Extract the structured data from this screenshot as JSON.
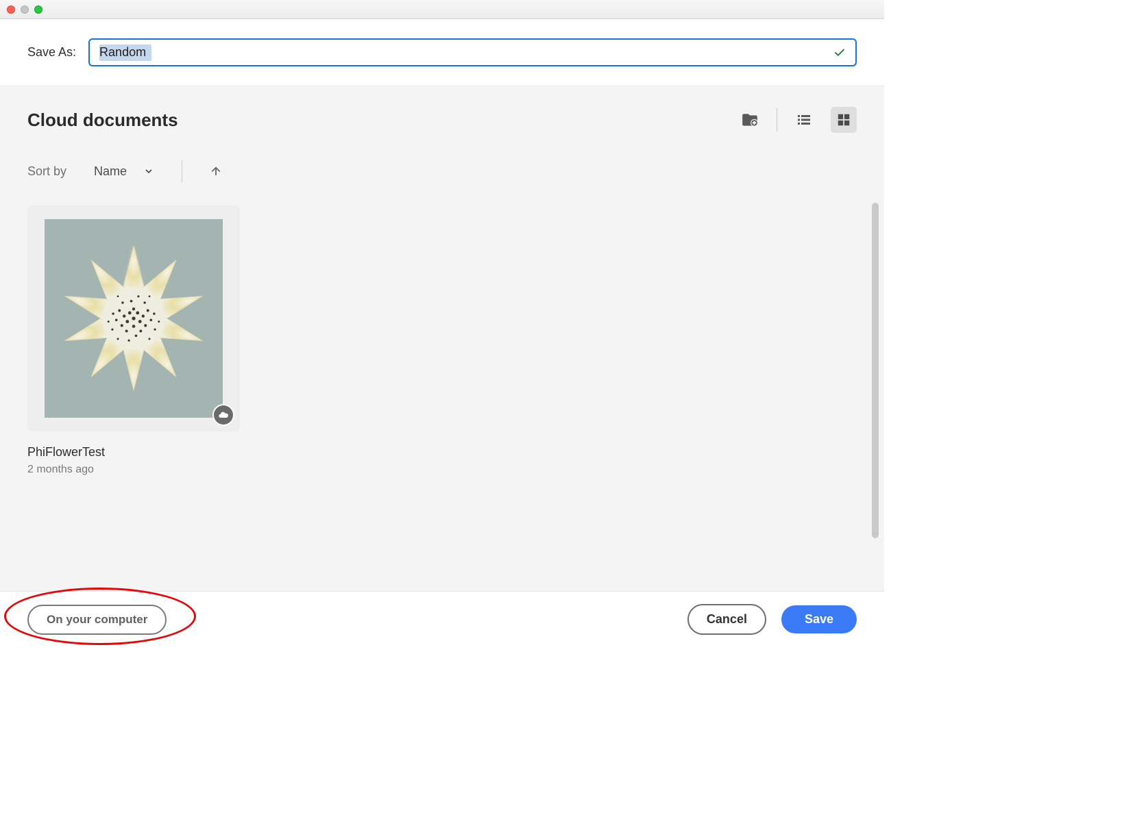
{
  "saveAs": {
    "label": "Save As:",
    "value": "Random"
  },
  "section": {
    "title": "Cloud documents"
  },
  "sort": {
    "label": "Sort by",
    "value": "Name"
  },
  "documents": [
    {
      "name": "PhiFlowerTest",
      "meta": "2 months ago"
    }
  ],
  "footer": {
    "localButton": "On your computer",
    "cancel": "Cancel",
    "save": "Save"
  }
}
